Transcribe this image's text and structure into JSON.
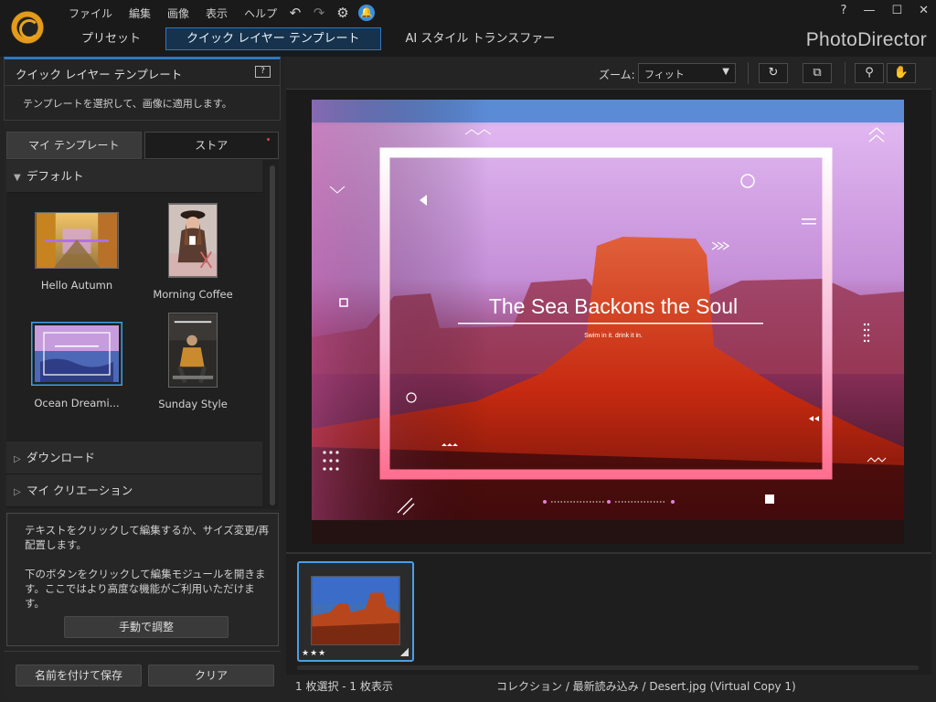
{
  "app": {
    "brand": "PhotoDirector",
    "menu": [
      "ファイル",
      "編集",
      "画像",
      "表示",
      "ヘルプ"
    ],
    "window_controls": [
      "?",
      "—",
      "☐",
      "✕"
    ],
    "tabs": [
      "プリセット",
      "クイック レイヤー テンプレート",
      "AI スタイル トランスファー"
    ],
    "active_tab": 1
  },
  "left_panel": {
    "title": "クイック レイヤー テンプレート",
    "help_icon": "?",
    "description": "テンプレートを選択して、画像に適用します。",
    "subtabs": [
      "マイ テンプレート",
      "ストア"
    ],
    "sections": {
      "default": "デフォルト",
      "download": "ダウンロード",
      "my_creations": "マイ クリエーション"
    },
    "templates": [
      {
        "name": "Hello Autumn"
      },
      {
        "name": "Morning Coffee"
      },
      {
        "name": "Ocean Dreami..."
      },
      {
        "name": "Sunday Style"
      }
    ],
    "info_text_1": "テキストをクリックして編集するか、サイズ変更/再配置します。",
    "info_text_2": "下のボタンをクリックして編集モジュールを開きます。ここではより高度な機能がご利用いただけます。",
    "manual_button": "手動で調整",
    "save_button": "名前を付けて保存",
    "clear_button": "クリア"
  },
  "toolbar": {
    "zoom_label": "ズーム:",
    "zoom_value": "フィット"
  },
  "canvas": {
    "headline": "The Sea Backons the Soul",
    "subline": "Swim in it. drink it in."
  },
  "filmstrip": {
    "stars": "★★★",
    "rating": 3
  },
  "status": {
    "selection": "1 枚選択 - 1 枚表示",
    "path": "コレクション / 最新読み込み / Desert.jpg (Virtual Copy 1)"
  }
}
